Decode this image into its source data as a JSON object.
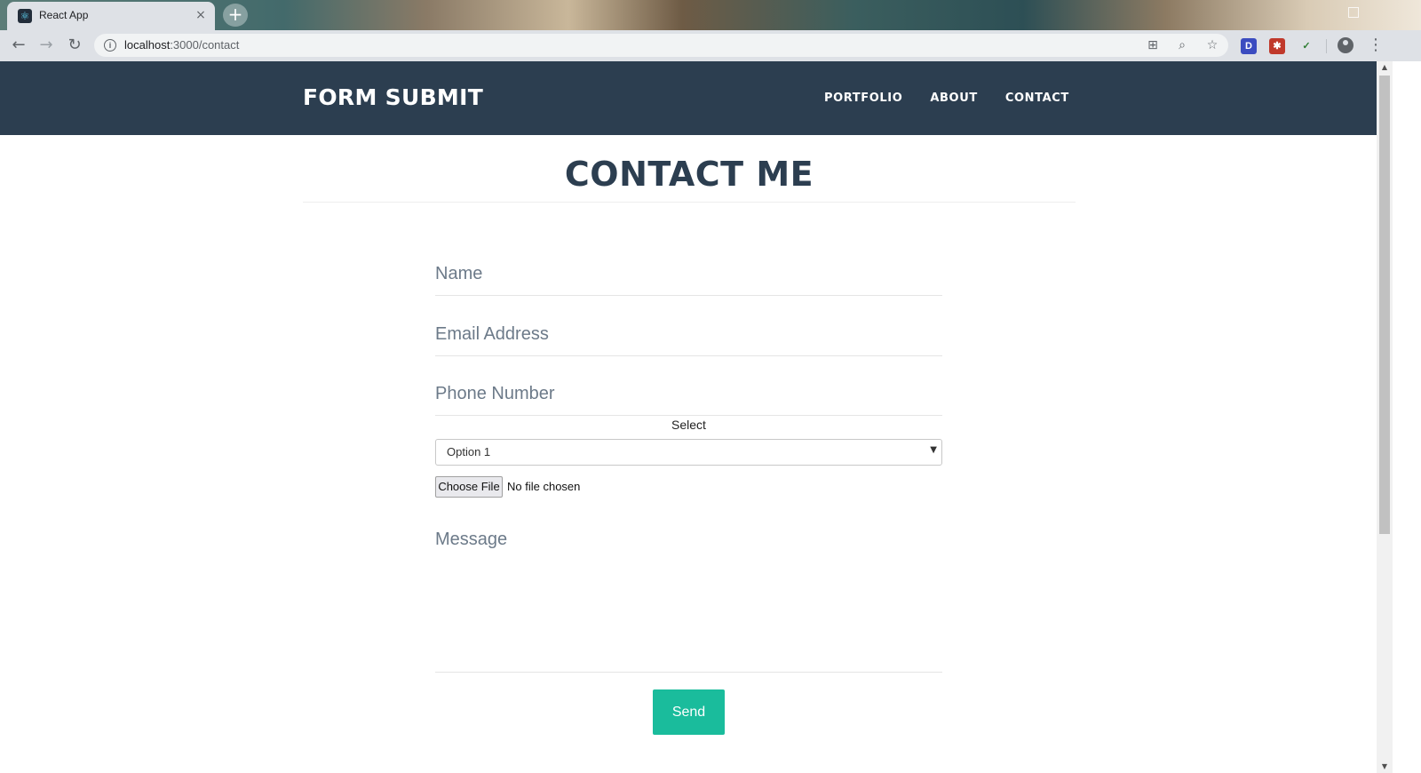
{
  "browser": {
    "tab_title": "React App",
    "tab_close": "×",
    "new_tab": "+",
    "url_host": "localhost",
    "url_path": ":3000/contact",
    "extensions": [
      {
        "name": "d-extension-icon",
        "label": "D",
        "color": "#3b4cc0"
      },
      {
        "name": "red-extension-icon",
        "label": "",
        "color": "#c0392b"
      }
    ]
  },
  "site": {
    "brand": "FORM SUBMIT",
    "nav": [
      "PORTFOLIO",
      "ABOUT",
      "CONTACT"
    ],
    "colors": {
      "nav_bg": "#2c3e50",
      "accent": "#1abc9c"
    }
  },
  "page": {
    "title": "CONTACT ME"
  },
  "form": {
    "name_placeholder": "Name",
    "email_placeholder": "Email Address",
    "phone_placeholder": "Phone Number",
    "select_label": "Select",
    "select_value": "Option 1",
    "file_button": "Choose File",
    "file_status": "No file chosen",
    "message_placeholder": "Message",
    "submit_label": "Send"
  }
}
